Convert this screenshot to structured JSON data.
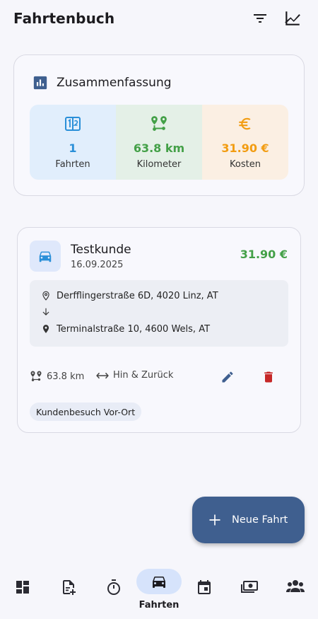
{
  "appbar": {
    "title": "Fahrtenbuch",
    "filter_icon": "filter-icon",
    "chart_icon": "line-chart-icon"
  },
  "summary": {
    "title": "Zusammenfassung",
    "stats": [
      {
        "value": "1",
        "label": "Fahrten",
        "color": "#2a8fd8",
        "icon": "counter-icon"
      },
      {
        "value": "63.8 km",
        "label": "Kilometer",
        "color": "#43a047",
        "icon": "route-icon"
      },
      {
        "value": "31.90 €",
        "label": "Kosten",
        "color": "#f29c11",
        "icon": "euro-icon"
      }
    ]
  },
  "trip": {
    "customer": "Testkunde",
    "date": "16.09.2025",
    "price": "31.90 €",
    "from": "Derfflingerstraße 6D, 4020 Linz, AT",
    "to": "Terminalstraße 10, 4600 Wels, AT",
    "distance": "63.8 km",
    "trip_type": "Hin & Zurück",
    "tag": "Kundenbesuch Vor-Ort"
  },
  "fab": {
    "label": "Neue Fahrt"
  },
  "nav": {
    "active_label": "Fahrten",
    "items": [
      "dashboard-icon",
      "note-add-icon",
      "timer-icon",
      "car-icon",
      "calendar-icon",
      "money-icon",
      "group-icon"
    ]
  },
  "colors": {
    "accent": "#3f5f8f",
    "delete": "#c62828",
    "edit": "#3f5f8f"
  }
}
